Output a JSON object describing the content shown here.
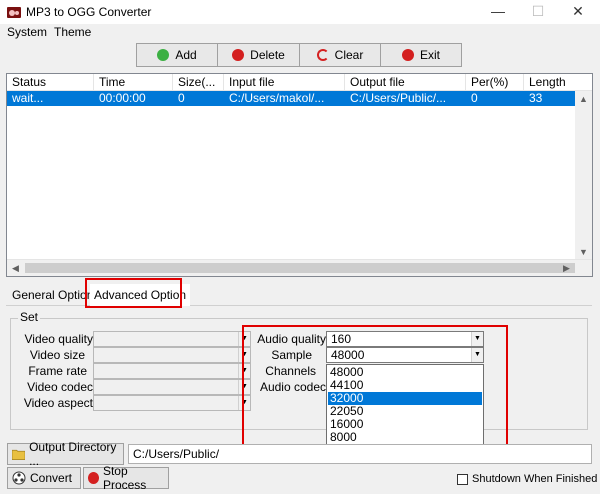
{
  "window": {
    "title": "MP3 to OGG Converter",
    "controls": {
      "minimize": "—",
      "maximize": "☐",
      "close": "✕"
    }
  },
  "menu": [
    "System",
    "Theme"
  ],
  "toolbar": {
    "add_label": "Add",
    "delete_label": "Delete",
    "clear_label": "Clear",
    "exit_label": "Exit"
  },
  "list": {
    "columns": [
      "Status",
      "Time",
      "Size(...",
      "Input file",
      "Output file",
      "Per(%)",
      "Length"
    ],
    "rows": [
      [
        "wait...",
        "00:00:00",
        "0",
        "C:/Users/makol/...",
        "C:/Users/Public/...",
        "0",
        "33"
      ]
    ]
  },
  "tabs": {
    "general": "General Option",
    "advanced": "Advanced Option"
  },
  "set_group": {
    "label": "Set",
    "video_quality": "Video quality",
    "video_size": "Video size",
    "frame_rate": "Frame rate",
    "video_codec": "Video codec",
    "video_aspect": "Video aspect",
    "audio_quality": "Audio quality",
    "audio_quality_value": "160",
    "sample": "Sample",
    "sample_value": "48000",
    "channels": "Channels",
    "audio_codec": "Audio codec"
  },
  "sample_options": [
    "48000",
    "44100",
    "32000",
    "22050",
    "16000",
    "8000"
  ],
  "sample_selected_index": 2,
  "bottom": {
    "output_dir_button": "Output Directory ...",
    "output_dir_value": "C:/Users/Public/",
    "convert_button": "Convert",
    "stop_button": "Stop Process",
    "shutdown_label": "Shutdown When Finished"
  },
  "colors": {
    "selection": "#0078d7",
    "highlight_frame": "#e00000"
  }
}
